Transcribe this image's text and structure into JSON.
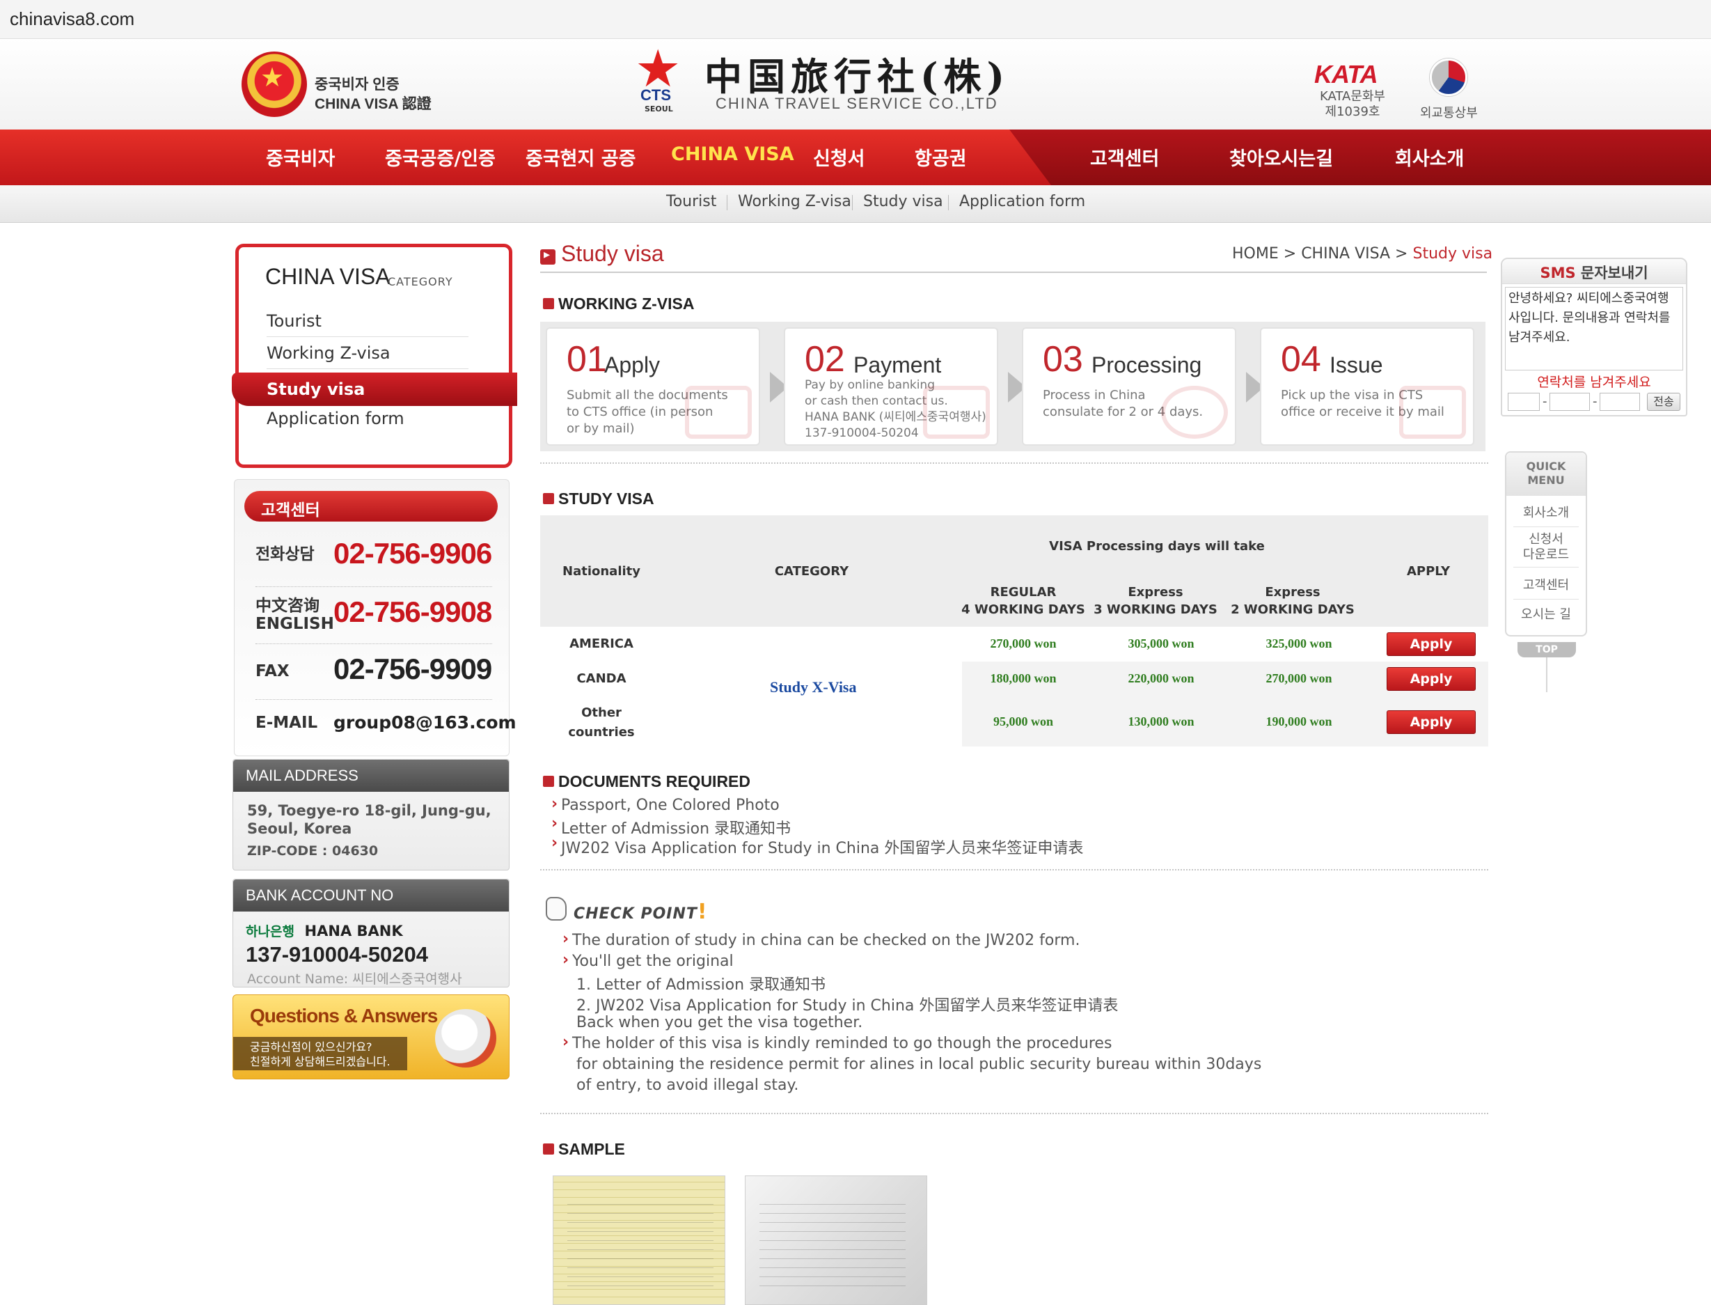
{
  "browser": {
    "url": "chinavisa8.com"
  },
  "header": {
    "left_logo_line1": "중국비자 인증",
    "left_logo_line2": "CHINA VISA 認證",
    "cts_abbr": "CTS",
    "cts_city": "SEOUL",
    "cts_chinese": "中国旅行社(株)",
    "cts_english": "CHINA TRAVEL SERVICE CO.,LTD",
    "kata_logo": "KATA",
    "kata_line1": "KATA문화부",
    "kata_line2": "제1039호",
    "mofat_label": "외교통상부"
  },
  "main_nav": {
    "items": [
      "중국비자",
      "중국공증/인증",
      "중국현지 공증",
      "CHINA VISA",
      "신청서",
      "항공권",
      "고객센터",
      "찾아오시는길",
      "회사소개"
    ],
    "active": "CHINA VISA"
  },
  "sub_nav": {
    "items": [
      "Tourist",
      "Working Z-visa",
      "Study visa",
      "Application form"
    ]
  },
  "category_box": {
    "title": "CHINA VISA",
    "subtitle": "CATEGORY",
    "items": [
      "Tourist",
      "Working Z-visa",
      "Study visa",
      "Application form"
    ],
    "active": "Study visa"
  },
  "customer_center": {
    "title": "고객센터",
    "phone_label": "전화상담",
    "phone": "02-756-9906",
    "chinese_label_1": "中文咨询",
    "chinese_label_2": "ENGLISH",
    "chinese_phone": "02-756-9908",
    "fax_label": "FAX",
    "fax": "02-756-9909",
    "email_label": "E-MAIL",
    "email": "group08@163.com"
  },
  "mail_address": {
    "title": "MAIL ADDRESS",
    "line1": "59, Toegye-ro 18-gil, Jung-gu,",
    "line2": "Seoul, Korea",
    "zip": "ZIP-CODE : 04630"
  },
  "bank_account": {
    "title": "BANK ACCOUNT NO",
    "bank_logo": "하나은행",
    "bank_name": "HANA BANK",
    "number": "137-910004-50204",
    "account_name": "Account Name: 씨티에스중국여행사"
  },
  "qa_banner": {
    "title": "Questions & Answers",
    "line1": "궁금하신점이 있으신가요?",
    "line2": "친절하게 상담해드리겠습니다."
  },
  "page": {
    "title": "Study visa",
    "breadcrumb_home": "HOME",
    "breadcrumb_sep": ">",
    "breadcrumb_mid": "CHINA VISA",
    "breadcrumb_current": "Study visa"
  },
  "process": {
    "heading": "WORKING Z-VISA",
    "steps": [
      {
        "num": "01",
        "name": "Apply",
        "desc": [
          "Submit all the documents",
          "to CTS office (in person",
          "or by mail)"
        ]
      },
      {
        "num": "02",
        "name": "Payment",
        "desc": [
          "Pay by online banking",
          "or cash then contact us.",
          "HANA BANK (씨티에스중국여행사)",
          "137-910004-50204"
        ]
      },
      {
        "num": "03",
        "name": "Processing",
        "desc": [
          "Process in China",
          "consulate for 2 or 4 days."
        ]
      },
      {
        "num": "04",
        "name": "Issue",
        "desc": [
          "Pick up the visa in CTS",
          "office or receive it by mail"
        ]
      }
    ]
  },
  "study_visa": {
    "heading": "STUDY VISA",
    "col_nationality": "Nationality",
    "col_category": "CATEGORY",
    "col_processing": "VISA Processing days will take",
    "col_regular_1": "REGULAR",
    "col_regular_2": "4 WORKING DAYS",
    "col_express3_1": "Express",
    "col_express3_2": "3 WORKING DAYS",
    "col_express2_1": "Express",
    "col_express2_2": "2 WORKING DAYS",
    "col_apply": "APPLY",
    "category": "Study X-Visa",
    "apply_label": "Apply",
    "rows": [
      {
        "nationality": "AMERICA",
        "nationality_2": "",
        "regular": "270,000 won",
        "express3": "305,000 won",
        "express2": "325,000 won"
      },
      {
        "nationality": "CANDA",
        "nationality_2": "",
        "regular": "180,000 won",
        "express3": "220,000 won",
        "express2": "270,000 won"
      },
      {
        "nationality": "Other",
        "nationality_2": "countries",
        "regular": "95,000 won",
        "express3": "130,000 won",
        "express2": "190,000 won"
      }
    ]
  },
  "documents": {
    "heading": "DOCUMENTS REQUIRED",
    "items": [
      "Passport, One Colored Photo",
      "Letter of Admission 录取通知书",
      "JW202 Visa Application for Study in China 外国留学人员来华签证申请表"
    ]
  },
  "check_point": {
    "title": "CHECK POINT",
    "bang": "!",
    "lines": [
      "The duration of study in china can be checked on the JW202 form.",
      "You'll get the original",
      "1. Letter of Admission 录取通知书",
      "2. JW202 Visa Application for Study in China 外国留学人员来华签证申请表",
      "Back when you get the visa together.",
      "The holder of this visa is kindly reminded to go though the procedures",
      "for obtaining the residence permit for alines in local public security bureau within 30days",
      "of entry, to avoid illegal stay."
    ]
  },
  "sample": {
    "heading": "SAMPLE"
  },
  "sms": {
    "title_prefix": "SMS",
    "title": "문자보내기",
    "message": "안녕하세요? 씨티에스중국여행사입니다. 문의내용과 연락처를 남겨주세요.",
    "prompt": "연락처를 남겨주세요",
    "send_label": "전송"
  },
  "quick_menu": {
    "title_1": "QUICK",
    "title_2": "MENU",
    "items": [
      "회사소개",
      "신청서",
      "다운로드",
      "고객센터",
      "오시는 길"
    ],
    "top_label": "TOP"
  }
}
